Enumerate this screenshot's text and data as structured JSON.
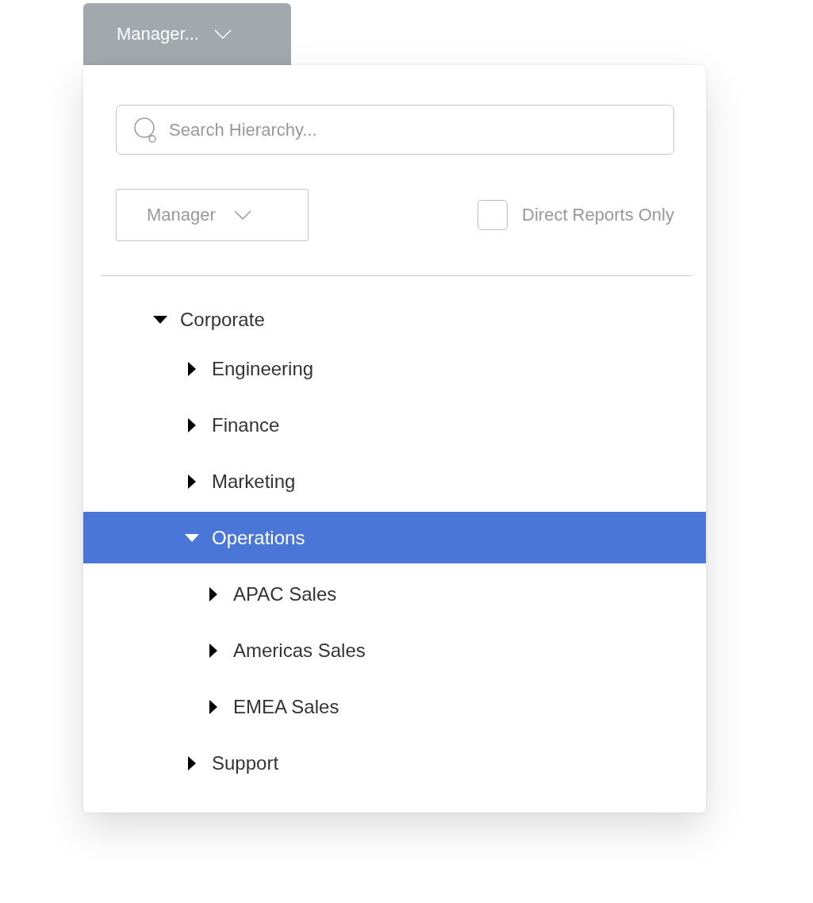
{
  "trigger": {
    "label": "Manager..."
  },
  "search": {
    "placeholder": "Search Hierarchy..."
  },
  "filter_dropdown": {
    "label": "Manager"
  },
  "direct_reports": {
    "label": "Direct Reports Only",
    "checked": false
  },
  "tree": [
    {
      "label": "Corporate",
      "expanded": true,
      "selected": false,
      "children": [
        {
          "label": "Engineering",
          "expanded": false,
          "selected": false
        },
        {
          "label": "Finance",
          "expanded": false,
          "selected": false
        },
        {
          "label": "Marketing",
          "expanded": false,
          "selected": false
        },
        {
          "label": "Operations",
          "expanded": true,
          "selected": true,
          "children": [
            {
              "label": "APAC Sales",
              "expanded": false,
              "selected": false
            },
            {
              "label": "Americas Sales",
              "expanded": false,
              "selected": false
            },
            {
              "label": "EMEA Sales",
              "expanded": false,
              "selected": false
            }
          ]
        },
        {
          "label": "Support",
          "expanded": false,
          "selected": false
        }
      ]
    }
  ]
}
